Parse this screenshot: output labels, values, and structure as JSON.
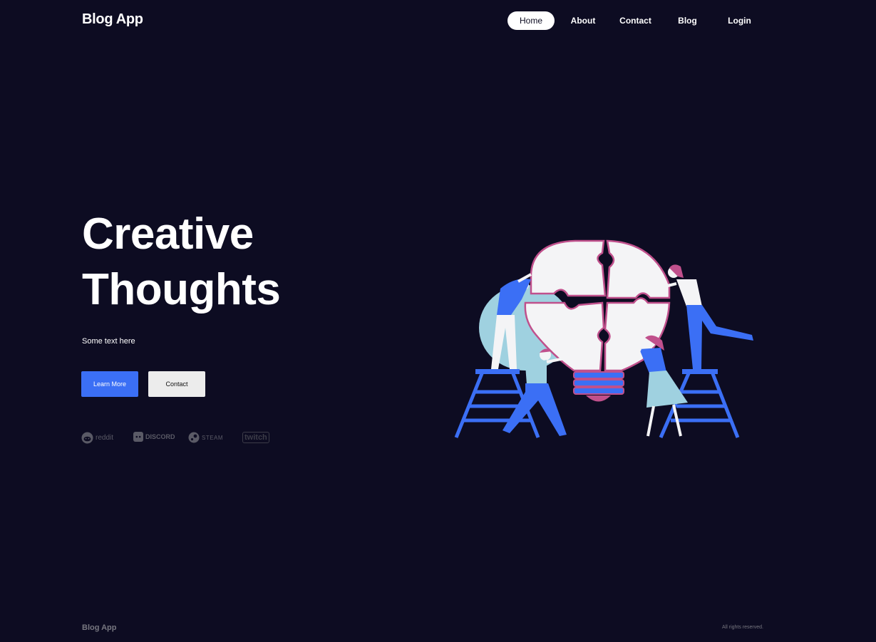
{
  "app": {
    "name": "Blog App"
  },
  "nav": {
    "items": [
      {
        "label": "Home",
        "active": true
      },
      {
        "label": "About"
      },
      {
        "label": "Contact"
      },
      {
        "label": "Blog"
      },
      {
        "label": "Login"
      }
    ]
  },
  "hero": {
    "title_line1": "Creative",
    "title_line2": "Thoughts",
    "subtitle": "Some text here",
    "primary_button": "Learn More",
    "secondary_button": "Contact",
    "illustration": "team-assembling-lightbulb-puzzle"
  },
  "brands": [
    {
      "label": "reddit",
      "icon": "reddit-icon"
    },
    {
      "label": "DISCORD",
      "icon": "discord-icon"
    },
    {
      "label": "STEAM",
      "icon": "steam-icon"
    },
    {
      "label": "twitch",
      "icon": "twitch-icon"
    }
  ],
  "footer": {
    "logo": "Blog App",
    "copyright": "All rights reserved."
  },
  "colors": {
    "background": "#0d0c22",
    "primary": "#3b6ff5",
    "secondary_button_bg": "#ececec",
    "muted_text": "#777780"
  }
}
